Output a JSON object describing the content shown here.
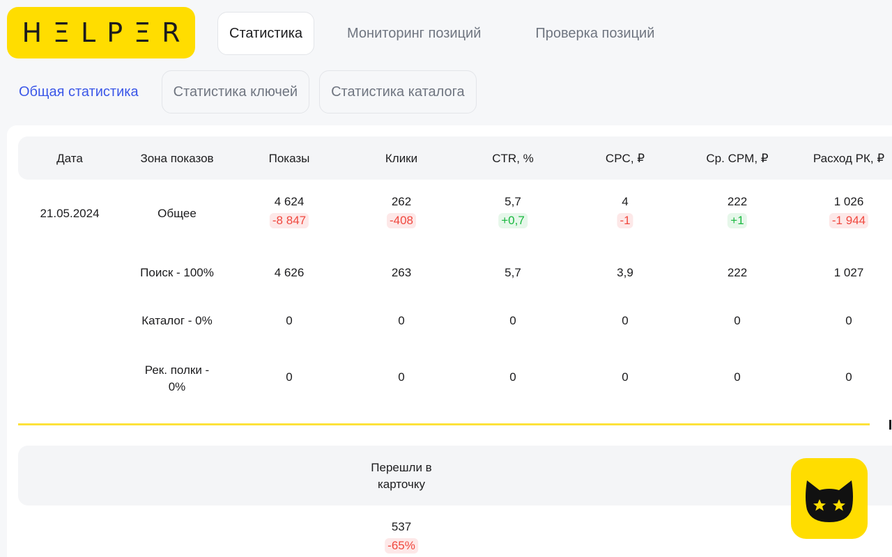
{
  "logo": {
    "text": "HΞLPΞR"
  },
  "topnav": [
    {
      "label": "Статистика",
      "active": true
    },
    {
      "label": "Мониторинг позиций",
      "active": false
    },
    {
      "label": "Проверка позиций",
      "active": false
    }
  ],
  "subnav": [
    {
      "label": "Общая статистика",
      "active": true
    },
    {
      "label": "Статистика ключей",
      "active": false
    },
    {
      "label": "Статистика каталога",
      "active": false
    }
  ],
  "table": {
    "headers": [
      "Дата",
      "Зона показов",
      "Показы",
      "Клики",
      "CTR, %",
      "CPC, ₽",
      "Ср. CPM, ₽",
      "Расход РК, ₽"
    ],
    "date": "21.05.2024",
    "rows": [
      {
        "zone": "Общее",
        "values": [
          "4 624",
          "262",
          "5,7",
          "4",
          "222",
          "1 026"
        ],
        "deltas": [
          "-8 847",
          "-408",
          "+0,7",
          "-1",
          "+1",
          "-1 944"
        ]
      },
      {
        "zone": "Поиск - 100%",
        "values": [
          "4 626",
          "263",
          "5,7",
          "3,9",
          "222",
          "1 027"
        ]
      },
      {
        "zone": "Каталог - 0%",
        "values": [
          "0",
          "0",
          "0",
          "0",
          "0",
          "0"
        ]
      },
      {
        "zone_line1": "Рек. полки -",
        "zone_line2": "0%",
        "values": [
          "0",
          "0",
          "0",
          "0",
          "0",
          "0"
        ]
      }
    ]
  },
  "table2": {
    "header_line1": "Перешли в",
    "header_line2": "карточку",
    "value": "537",
    "delta": "-65%"
  },
  "colors": {
    "brand": "#ffdd00",
    "accent": "#3b57e8",
    "negative": "#f0483e",
    "positive": "#19b83f"
  }
}
